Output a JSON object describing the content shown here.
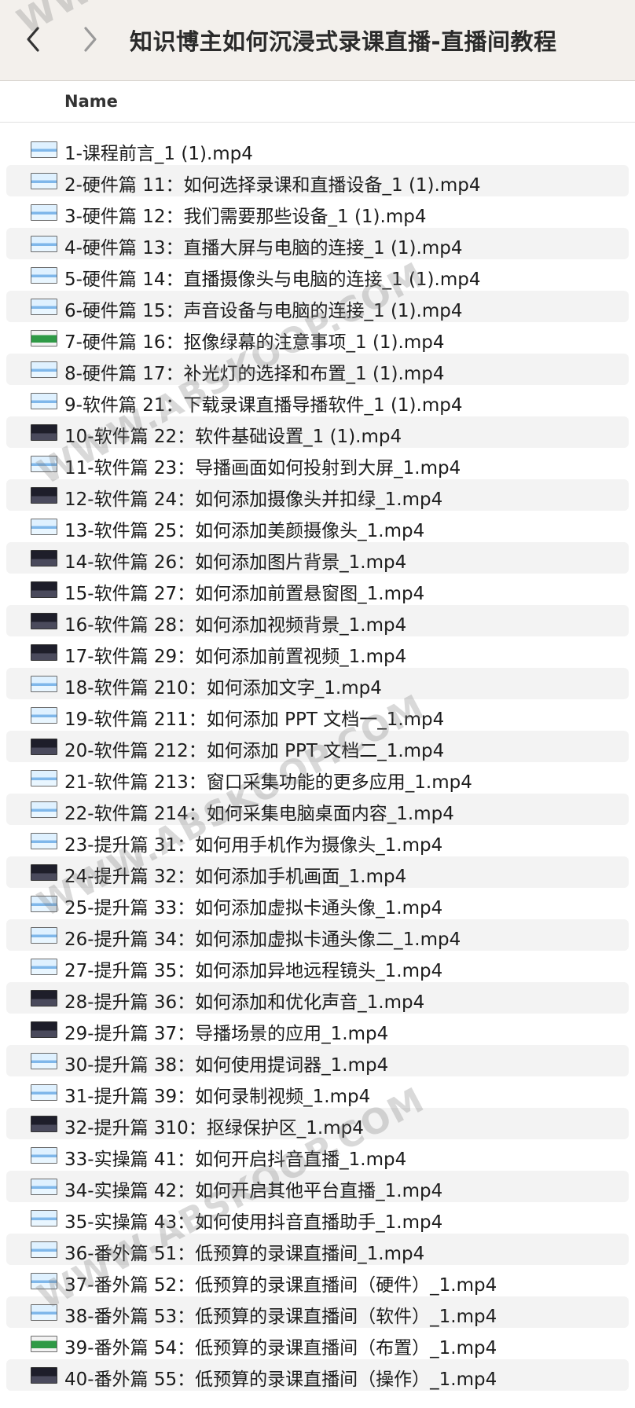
{
  "window": {
    "title": "知识博主如何沉浸式录课直播-直播间教程",
    "back_icon": "chevron-left-icon",
    "forward_icon": "chevron-right-icon"
  },
  "list_header": {
    "name": "Name"
  },
  "files": [
    {
      "name": "1-课程前言_1 (1).mp4",
      "thumb": "light"
    },
    {
      "name": "2-硬件篇 11：如何选择录课和直播设备_1 (1).mp4",
      "thumb": "light"
    },
    {
      "name": "3-硬件篇 12：我们需要那些设备_1 (1).mp4",
      "thumb": "light"
    },
    {
      "name": "4-硬件篇 13：直播大屏与电脑的连接_1 (1).mp4",
      "thumb": "light"
    },
    {
      "name": "5-硬件篇 14：直播摄像头与电脑的连接_1 (1).mp4",
      "thumb": "light"
    },
    {
      "name": "6-硬件篇 15：声音设备与电脑的连接_1 (1).mp4",
      "thumb": "light"
    },
    {
      "name": "7-硬件篇 16：抠像绿幕的注意事项_1 (1).mp4",
      "thumb": "green"
    },
    {
      "name": "8-硬件篇 17：补光灯的选择和布置_1 (1).mp4",
      "thumb": "light"
    },
    {
      "name": "9-软件篇 21：下载录课直播导播软件_1 (1).mp4",
      "thumb": "light"
    },
    {
      "name": "10-软件篇 22：软件基础设置_1 (1).mp4",
      "thumb": "dark"
    },
    {
      "name": "11-软件篇 23：导播画面如何投射到大屏_1.mp4",
      "thumb": "light"
    },
    {
      "name": "12-软件篇 24：如何添加摄像头并扣绿_1.mp4",
      "thumb": "dark"
    },
    {
      "name": "13-软件篇 25：如何添加美颜摄像头_1.mp4",
      "thumb": "light"
    },
    {
      "name": "14-软件篇 26：如何添加图片背景_1.mp4",
      "thumb": "dark"
    },
    {
      "name": "15-软件篇 27：如何添加前置悬窗图_1.mp4",
      "thumb": "dark"
    },
    {
      "name": "16-软件篇 28：如何添加视频背景_1.mp4",
      "thumb": "dark"
    },
    {
      "name": "17-软件篇 29：如何添加前置视频_1.mp4",
      "thumb": "dark"
    },
    {
      "name": "18-软件篇 210：如何添加文字_1.mp4",
      "thumb": "light"
    },
    {
      "name": "19-软件篇 211：如何添加 PPT 文档一_1.mp4",
      "thumb": "light"
    },
    {
      "name": "20-软件篇 212：如何添加 PPT 文档二_1.mp4",
      "thumb": "dark"
    },
    {
      "name": "21-软件篇 213：窗口采集功能的更多应用_1.mp4",
      "thumb": "light"
    },
    {
      "name": "22-软件篇 214：如何采集电脑桌面内容_1.mp4",
      "thumb": "light"
    },
    {
      "name": "23-提升篇 31：如何用手机作为摄像头_1.mp4",
      "thumb": "light"
    },
    {
      "name": "24-提升篇 32：如何添加手机画面_1.mp4",
      "thumb": "dark"
    },
    {
      "name": "25-提升篇 33：如何添加虚拟卡通头像_1.mp4",
      "thumb": "light"
    },
    {
      "name": "26-提升篇 34：如何添加虚拟卡通头像二_1.mp4",
      "thumb": "light"
    },
    {
      "name": "27-提升篇 35：如何添加异地远程镜头_1.mp4",
      "thumb": "light"
    },
    {
      "name": "28-提升篇 36：如何添加和优化声音_1.mp4",
      "thumb": "dark"
    },
    {
      "name": "29-提升篇 37：导播场景的应用_1.mp4",
      "thumb": "dark"
    },
    {
      "name": "30-提升篇 38：如何使用提词器_1.mp4",
      "thumb": "light"
    },
    {
      "name": "31-提升篇 39：如何录制视频_1.mp4",
      "thumb": "light"
    },
    {
      "name": "32-提升篇 310：抠绿保护区_1.mp4",
      "thumb": "dark"
    },
    {
      "name": "33-实操篇 41：如何开启抖音直播_1.mp4",
      "thumb": "light"
    },
    {
      "name": "34-实操篇 42：如何开启其他平台直播_1.mp4",
      "thumb": "light"
    },
    {
      "name": "35-实操篇 43：如何使用抖音直播助手_1.mp4",
      "thumb": "light"
    },
    {
      "name": "36-番外篇 51：低预算的录课直播间_1.mp4",
      "thumb": "light"
    },
    {
      "name": "37-番外篇 52：低预算的录课直播间（硬件）_1.mp4",
      "thumb": "light"
    },
    {
      "name": "38-番外篇 53：低预算的录课直播间（软件）_1.mp4",
      "thumb": "light"
    },
    {
      "name": "39-番外篇 54：低预算的录课直播间（布置）_1.mp4",
      "thumb": "green"
    },
    {
      "name": "40-番外篇 55：低预算的录课直播间（操作）_1.mp4",
      "thumb": "dark"
    }
  ],
  "watermarks": [
    "WWW.ABSKOOP.COM",
    "WWW.ABSKOOP.COM",
    "WWW.ABSKOOP.COM",
    "WW"
  ]
}
